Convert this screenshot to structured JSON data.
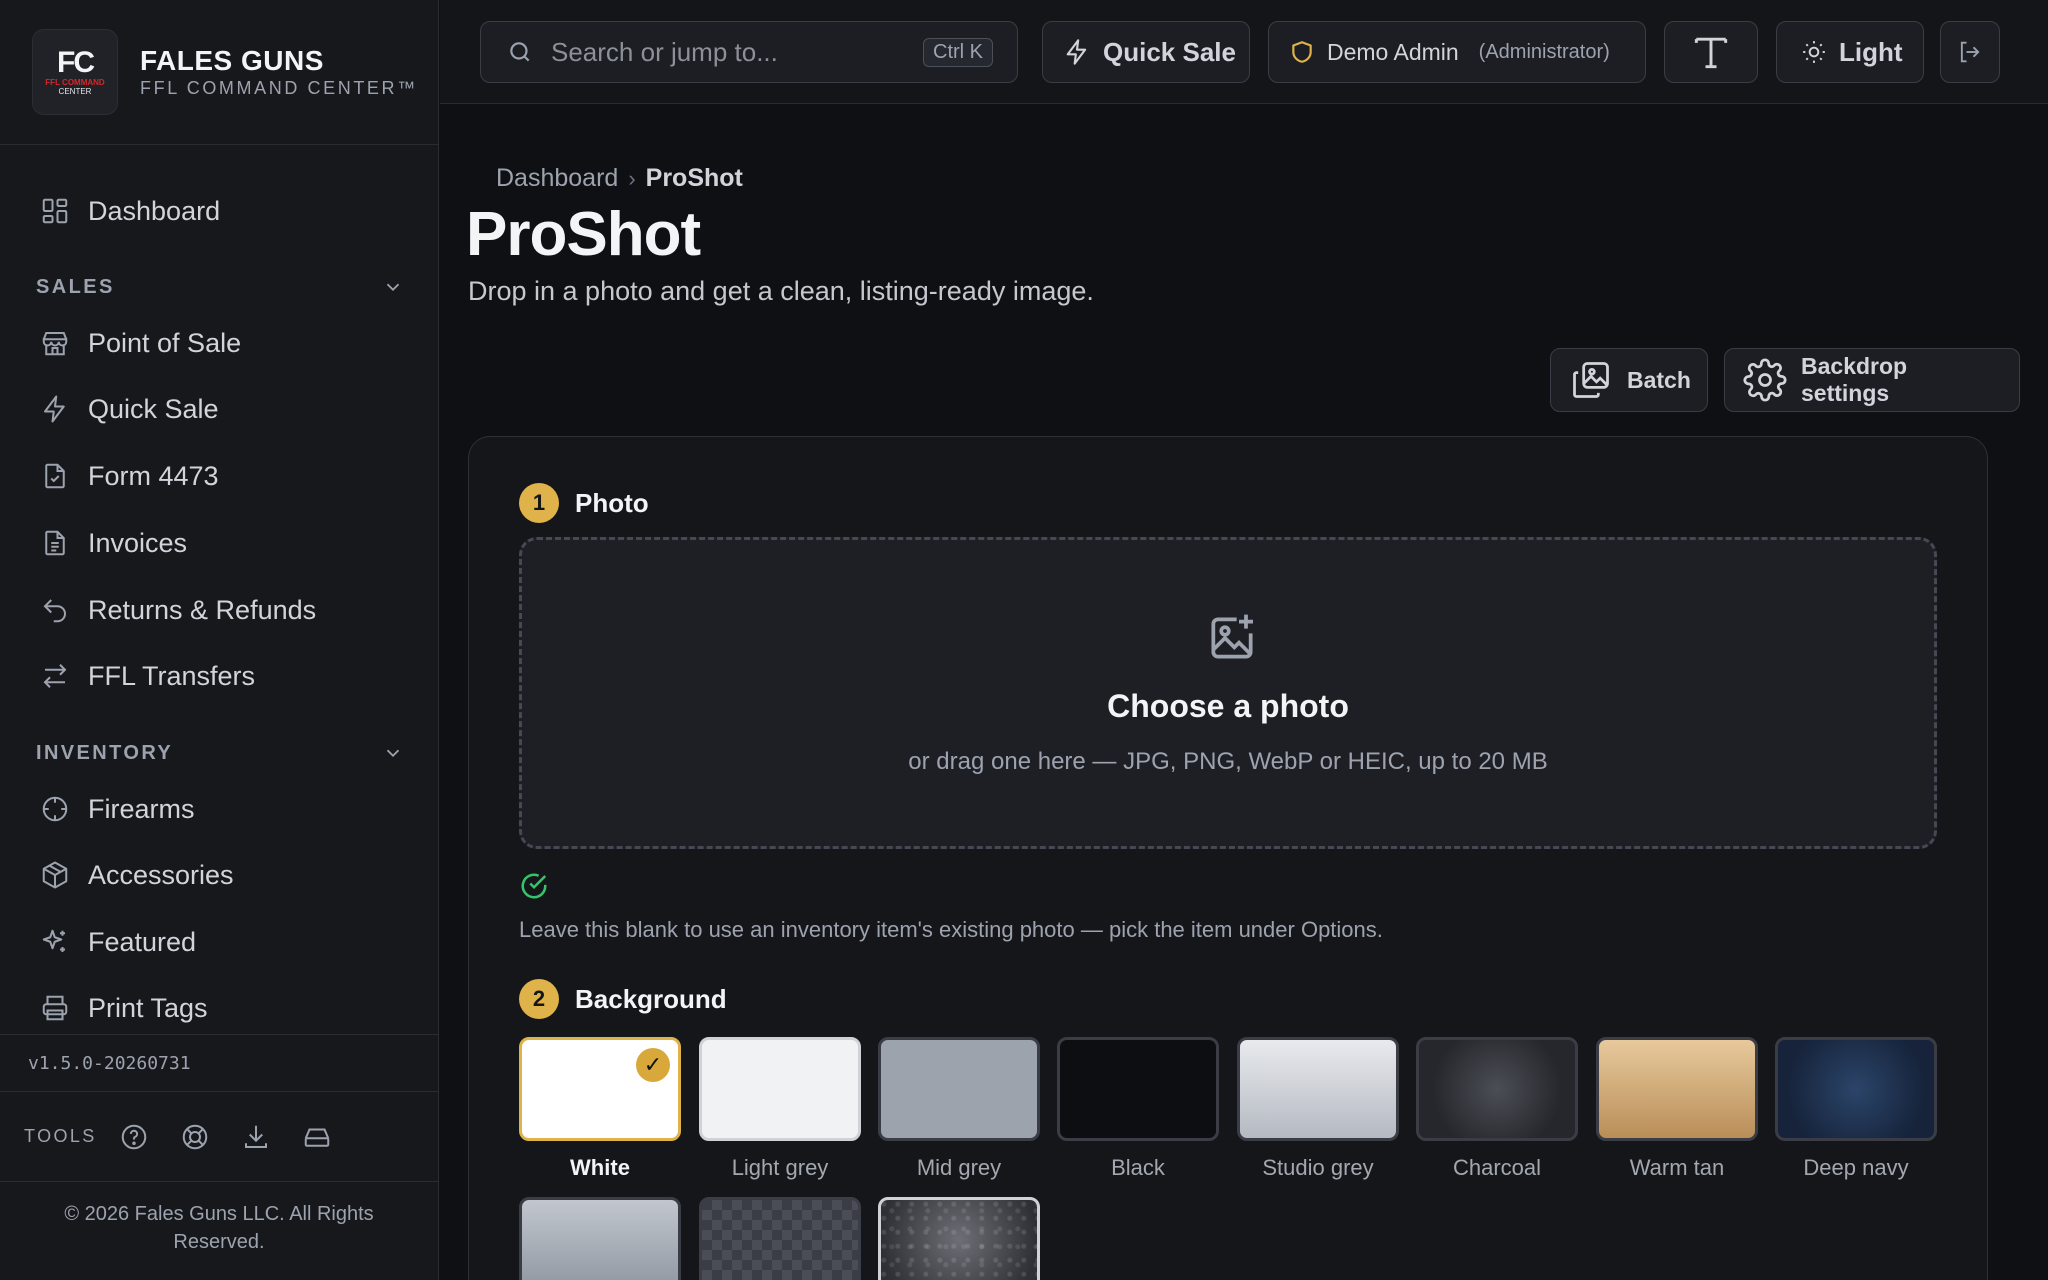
{
  "brand": {
    "logo_text": "FC",
    "logo_sub": "FFL COMMAND",
    "logo_sub2": "CENTER",
    "title": "FALES GUNS",
    "subtitle": "FFL COMMAND CENTER™"
  },
  "sidebar": {
    "dashboard": "Dashboard",
    "sections": [
      {
        "label": "SALES",
        "items": [
          "Point of Sale",
          "Quick Sale",
          "Form 4473",
          "Invoices",
          "Returns & Refunds",
          "FFL Transfers"
        ]
      },
      {
        "label": "INVENTORY",
        "items": [
          "Firearms",
          "Accessories",
          "Featured",
          "Print Tags"
        ]
      }
    ],
    "version": "v1.5.0-20260731",
    "tools_label": "TOOLS",
    "tools": [
      "help-icon",
      "support-icon",
      "download-icon",
      "drive-icon"
    ],
    "copyright": "© 2026 Fales Guns LLC. All Rights Reserved."
  },
  "topbar": {
    "search_placeholder": "Search or jump to...",
    "search_shortcut": "Ctrl K",
    "quick_sale": "Quick Sale",
    "user_name": "Demo Admin",
    "user_role": "(Administrator)",
    "theme_label": "Light"
  },
  "breadcrumb": {
    "home": "Dashboard",
    "separator": "›",
    "current": "ProShot"
  },
  "page": {
    "title": "ProShot",
    "subtitle": "Drop in a photo and get a clean, listing-ready image."
  },
  "actions": {
    "batch": "Batch",
    "backdrop_settings": "Backdrop settings"
  },
  "photo_step": {
    "number": "1",
    "title": "Photo",
    "dropzone_title": "Choose a photo",
    "dropzone_hint": "or drag one here — JPG, PNG, WebP or HEIC, up to 20 MB",
    "blank_hint": "Leave this blank to use an inventory item's existing photo — pick the item under Options."
  },
  "background_step": {
    "number": "2",
    "title": "Background",
    "selected": "White",
    "check_mark": "✓",
    "options": [
      {
        "label": "White",
        "style": "white"
      },
      {
        "label": "Light grey",
        "style": "lightgrey"
      },
      {
        "label": "Mid grey",
        "style": "midgrey"
      },
      {
        "label": "Black",
        "style": "black"
      },
      {
        "label": "Studio grey",
        "style": "studio"
      },
      {
        "label": "Charcoal",
        "style": "charcoal"
      },
      {
        "label": "Warm tan",
        "style": "warmtan"
      },
      {
        "label": "Deep navy",
        "style": "navy"
      },
      {
        "label": "",
        "style": "silver"
      },
      {
        "label": "",
        "style": "checker"
      },
      {
        "label": "",
        "style": "texture"
      }
    ]
  },
  "colors": {
    "accent": "#e0b34a",
    "success": "#34c46b",
    "background": "#0f1013",
    "sidebar": "#17181c"
  }
}
